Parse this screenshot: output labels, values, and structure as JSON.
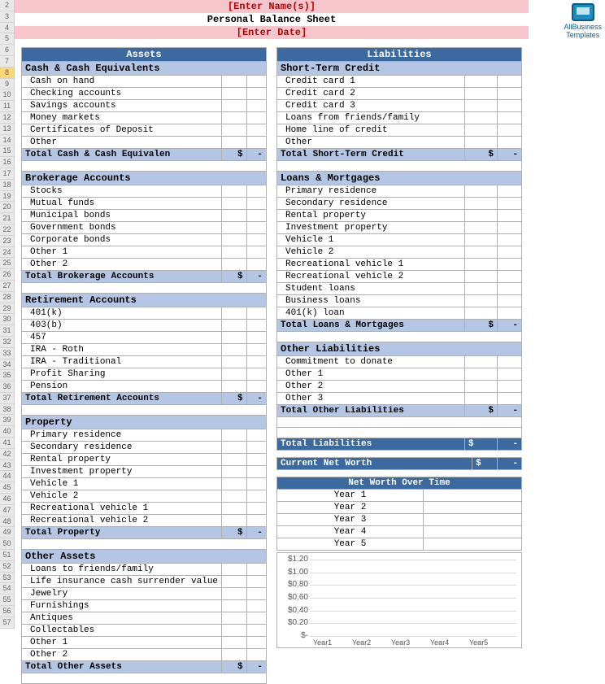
{
  "header": {
    "names_placeholder": "[Enter Name(s)]",
    "title": "Personal Balance Sheet",
    "date_placeholder": "[Enter Date]"
  },
  "logo": {
    "line1": "AllBusiness",
    "line2": "Templates"
  },
  "assets": {
    "col_title": "Assets",
    "sections": [
      {
        "head": "Cash & Cash Equivalents",
        "items": [
          "Cash on hand",
          "Checking accounts",
          "Savings accounts",
          "Money markets",
          "Certificates of Deposit",
          "Other"
        ],
        "total_label": "Total Cash & Cash Equivalen",
        "amt": "$",
        "dash": "-"
      },
      {
        "head": "Brokerage Accounts",
        "items": [
          "Stocks",
          "Mutual funds",
          "Municipal bonds",
          "Government bonds",
          "Corporate bonds",
          "Other 1",
          "Other 2"
        ],
        "total_label": "Total Brokerage Accounts",
        "amt": "$",
        "dash": "-"
      },
      {
        "head": "Retirement Accounts",
        "items": [
          "401(k)",
          "403(b)",
          "457",
          "IRA - Roth",
          "IRA - Traditional",
          "Profit Sharing",
          "Pension"
        ],
        "total_label": "Total Retirement Accounts",
        "amt": "$",
        "dash": "-"
      },
      {
        "head": "Property",
        "items": [
          "Primary  residence",
          "Secondary residence",
          "Rental property",
          "Investment property",
          "Vehicle 1",
          "Vehicle 2",
          "Recreational vehicle 1",
          "Recreational vehicle 2"
        ],
        "total_label": "Total Property",
        "amt": "$",
        "dash": "-"
      },
      {
        "head": "Other Assets",
        "items": [
          "Loans to friends/family",
          "Life insurance cash surrender value",
          "Jewelry",
          "Furnishings",
          "Antiques",
          "Collectables",
          "Other 1",
          "Other 2"
        ],
        "total_label": "Total Other Assets",
        "amt": "$",
        "dash": "-"
      }
    ]
  },
  "liabilities": {
    "col_title": "Liabilities",
    "sections": [
      {
        "head": "Short-Term Credit",
        "items": [
          "Credit card 1",
          "Credit card 2",
          "Credit card 3",
          "Loans from friends/family",
          "Home line of credit",
          "Other"
        ],
        "total_label": "Total Short-Term Credit",
        "amt": "$",
        "dash": "-"
      },
      {
        "head": "Loans & Mortgages",
        "items": [
          "Primary  residence",
          "Secondary residence",
          "Rental property",
          "Investment property",
          "Vehicle 1",
          "Vehicle 2",
          "Recreational vehicle 1",
          "Recreational vehicle 2",
          "Student loans",
          "Business loans",
          "401(k) loan"
        ],
        "total_label": "Total Loans & Mortgages",
        "amt": "$",
        "dash": "-"
      },
      {
        "head": "Other Liabilities",
        "items": [
          "Commitment to donate",
          "Other 1",
          "Other 2",
          "Other 3"
        ],
        "total_label": "Total Other Liabilities",
        "amt": "$",
        "dash": "-"
      }
    ],
    "grand_total_label": "Total Liabilities",
    "grand_amt": "$",
    "grand_dash": "-"
  },
  "networth": {
    "current_label": "Current Net Worth",
    "current_amt": "$",
    "current_dash": "-",
    "over_time_title": "Net Worth Over Time",
    "rows": [
      "Year 1",
      "Year 2",
      "Year 3",
      "Year 4",
      "Year 5"
    ]
  },
  "chart_data": {
    "type": "bar",
    "categories": [
      "Year1",
      "Year2",
      "Year3",
      "Year4",
      "Year5"
    ],
    "values": [
      null,
      null,
      null,
      null,
      null
    ],
    "title": "",
    "xlabel": "",
    "ylabel": "",
    "yticks": [
      "$1.20",
      "$1.00",
      "$0.80",
      "$0.60",
      "$0.40",
      "$0.20",
      "$-"
    ],
    "ylim": [
      0,
      1.2
    ]
  },
  "row_numbers_start": 2,
  "row_numbers_end": 57,
  "row_selected": 8
}
